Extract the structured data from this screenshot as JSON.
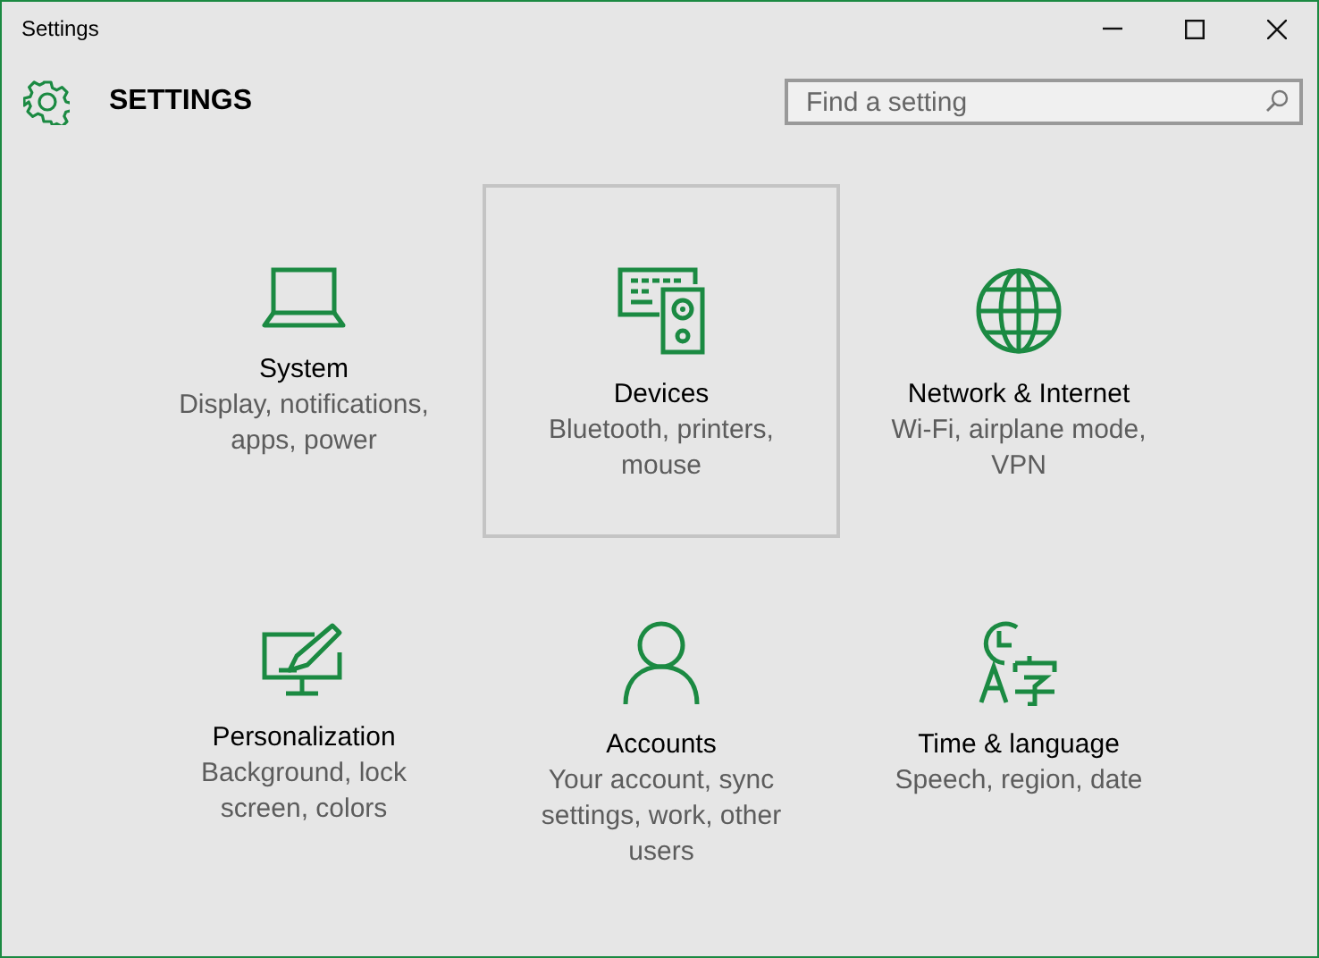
{
  "window": {
    "title": "Settings",
    "controls": [
      {
        "kind": "minimize"
      },
      {
        "kind": "maximize"
      },
      {
        "kind": "close"
      }
    ]
  },
  "header": {
    "title": "SETTINGS",
    "search": {
      "placeholder": "Find a setting"
    }
  },
  "tiles": [
    {
      "kind": "system",
      "title": "System",
      "description": "Display, notifications, apps, power",
      "selected": false
    },
    {
      "kind": "devices",
      "title": "Devices",
      "description": "Bluetooth, printers, mouse",
      "selected": true
    },
    {
      "kind": "network",
      "title": "Network & Internet",
      "description": "Wi-Fi, airplane mode, VPN",
      "selected": false
    },
    {
      "kind": "personalization",
      "title": "Personalization",
      "description": "Background, lock screen, colors",
      "selected": false
    },
    {
      "kind": "accounts",
      "title": "Accounts",
      "description": "Your account, sync settings, work, other users",
      "selected": false
    },
    {
      "kind": "time",
      "title": "Time & language",
      "description": "Speech, region, date",
      "selected": false
    }
  ]
}
